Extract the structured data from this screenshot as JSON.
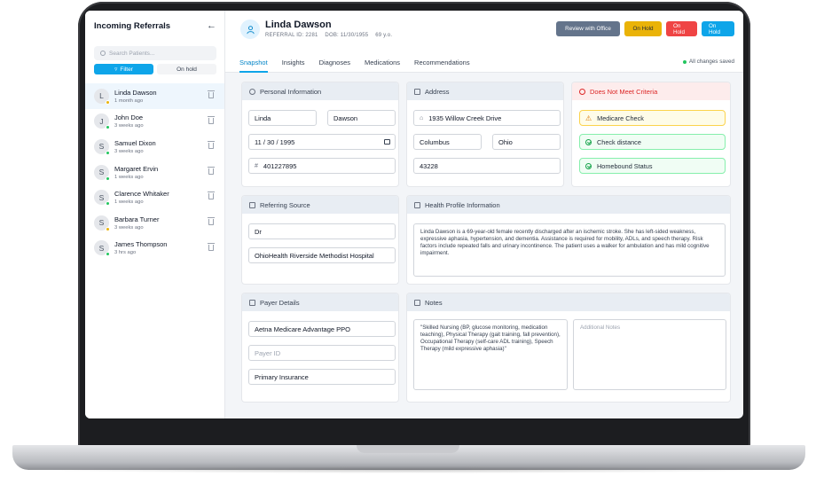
{
  "sidebar": {
    "title": "Incoming Referrals",
    "back_icon": "arrow-left-icon",
    "search_placeholder": "Search Patients...",
    "filter_label": "Filter",
    "onhold_label": "On hold",
    "patients": [
      {
        "initial": "L",
        "name": "Linda Dawson",
        "time": "1 month ago",
        "status_color": "#eab308"
      },
      {
        "initial": "J",
        "name": "John Doe",
        "time": "3 weeks ago",
        "status_color": "#22c55e"
      },
      {
        "initial": "S",
        "name": "Samuel Dixon",
        "time": "3 weeks ago",
        "status_color": "#22c55e"
      },
      {
        "initial": "S",
        "name": "Margaret Ervin",
        "time": "1 weeks ago",
        "status_color": "#22c55e"
      },
      {
        "initial": "S",
        "name": "Clarence Whitaker",
        "time": "1 weeks ago",
        "status_color": "#22c55e"
      },
      {
        "initial": "S",
        "name": "Barbara Turner",
        "time": "3 weeks ago",
        "status_color": "#eab308"
      },
      {
        "initial": "S",
        "name": "James Thompson",
        "time": "3 hrs ago",
        "status_color": "#22c55e"
      }
    ]
  },
  "header": {
    "patient_name": "Linda Dawson",
    "referral_id": "REFERRAL ID: 2281",
    "dob": "DOB: 11/30/1955",
    "age": "69 y.o.",
    "actions": {
      "review": "Review with Office",
      "hold_yellow": "On Hold",
      "hold_red": "On Hold",
      "hold_blue": "On Hold"
    },
    "tabs": [
      "Snapshot",
      "Insights",
      "Diagnoses",
      "Medications",
      "Recommendations"
    ],
    "saved_status": "All changes saved"
  },
  "personal": {
    "title": "Personal Information",
    "first_name": "Linda",
    "last_name": "Dawson",
    "dob": "11 / 30 / 1995",
    "id_prefix": "#",
    "id": "401227895"
  },
  "address": {
    "title": "Address",
    "street": "1935 Willow Creek Drive",
    "city": "Columbus",
    "state": "Ohio",
    "zip": "43228"
  },
  "criteria": {
    "title": "Does Not Meet Criteria",
    "items": [
      "Medicare Check",
      "Check distance",
      "Homebound Status"
    ]
  },
  "referring": {
    "title": "Referring Source",
    "name": "Dr",
    "facility": "OhioHealth Riverside Methodist Hospital"
  },
  "health": {
    "title": "Health Profile Information",
    "text": "Linda Dawson is a 69-year-old female recently discharged after an ischemic stroke. She has left-sided weakness, expressive aphasia, hypertension, and dementia. Assistance is required for mobility, ADLs, and speech therapy. Risk factors include repeated falls and urinary incontinence. The patient uses a walker for ambulation and has mild cognitive impairment."
  },
  "payer": {
    "title": "Payer Details",
    "plan": "Aetna Medicare Advantage PPO",
    "payer_id_placeholder": "Payer ID",
    "type": "Primary Insurance"
  },
  "notes": {
    "title": "Notes",
    "text": "\"Skilled Nursing (BP, glucose monitoring, medication teaching), Physical Therapy (gait training, fall prevention), Occupational Therapy (self-care ADL training), Speech Therapy (mild expressive aphasia)\"",
    "additional_placeholder": "Additional Notes"
  }
}
